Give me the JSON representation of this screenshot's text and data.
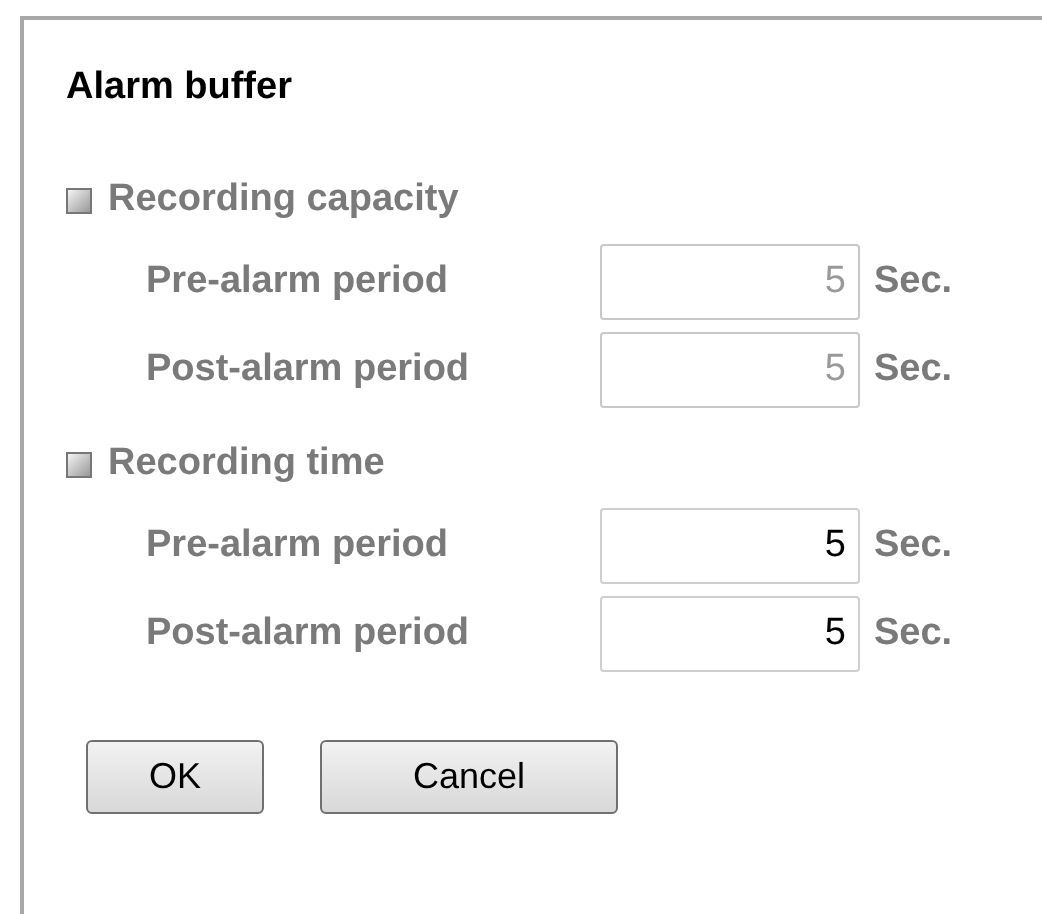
{
  "title": "Alarm buffer",
  "options": [
    {
      "label": "Recording capacity",
      "selected": false,
      "fields": [
        {
          "label": "Pre-alarm period",
          "value": "5",
          "unit": "Sec.",
          "disabled": true
        },
        {
          "label": "Post-alarm period",
          "value": "5",
          "unit": "Sec.",
          "disabled": true
        }
      ]
    },
    {
      "label": "Recording time",
      "selected": false,
      "fields": [
        {
          "label": "Pre-alarm period",
          "value": "5",
          "unit": "Sec.",
          "disabled": false
        },
        {
          "label": "Post-alarm period",
          "value": "5",
          "unit": "Sec.",
          "disabled": false
        }
      ]
    }
  ],
  "buttons": [
    "OK",
    "Cancel"
  ]
}
